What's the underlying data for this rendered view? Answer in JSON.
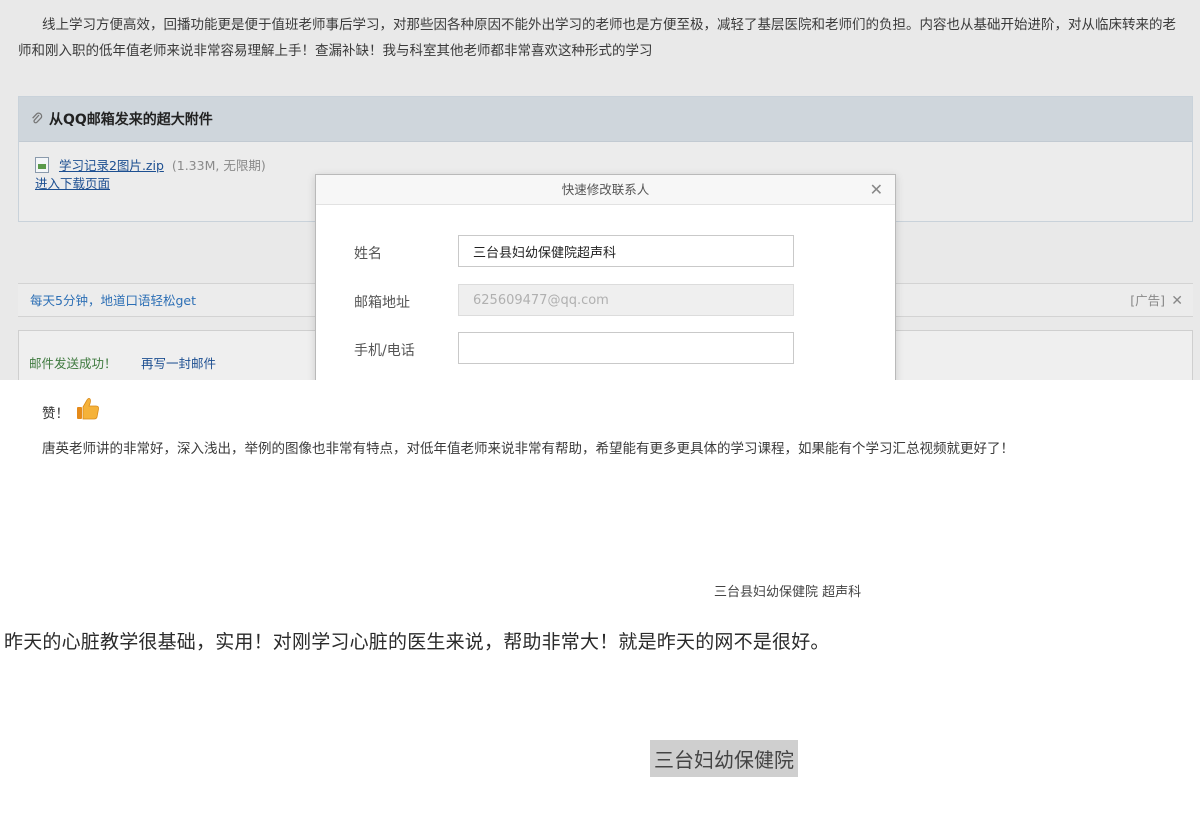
{
  "mail": {
    "body_text": "线上学习方便高效，回播功能更是便于值班老师事后学习，对那些因各种原因不能外出学习的老师也是方便至极，减轻了基层医院和老师们的负担。内容也从基础开始进阶，对从临床转来的老师和刚入职的低年值老师来说非常容易理解上手！查漏补缺！我与科室其他老师都非常喜欢这种形式的学习",
    "attachment": {
      "header": "从QQ邮箱发来的超大附件",
      "file_name": "学习记录2图片.zip",
      "file_meta": "(1.33M, 无限期)",
      "download_link": "进入下载页面"
    },
    "ad": {
      "text": "每天5分钟，地道口语轻松get",
      "tag": "[广告]",
      "close": "✕"
    },
    "sent": {
      "message": "邮件发送成功！",
      "resend": "再写一封邮件"
    },
    "dialog": {
      "title": "快速修改联系人",
      "close": "✕",
      "fields": [
        {
          "label": "姓名",
          "value": "三台县妇幼保健院超声科",
          "placeholder": ""
        },
        {
          "label": "邮箱地址",
          "value": "625609477@qq.com",
          "placeholder": ""
        },
        {
          "label": "手机/电话",
          "value": "",
          "placeholder": ""
        }
      ]
    }
  },
  "comments": {
    "praise": "赞！",
    "comment1": "唐英老师讲的非常好，深入浅出，举例的图像也非常有特点，对低年值老师来说非常有帮助，希望能有更多更具体的学习课程，如果能有个学习汇总视频就更好了！",
    "sign1": "三台县妇幼保健院  超声科",
    "comment2": "昨天的心脏教学很基础，实用！对刚学习心脏的医生来说，帮助非常大！就是昨天的网不是很好。",
    "sign2": "三台妇幼保健院"
  },
  "colors": {
    "accent_link": "#1d4f91",
    "ad_link": "#2d6fb5",
    "success": "#3f7a3f",
    "thumb": "#f0a12a"
  }
}
